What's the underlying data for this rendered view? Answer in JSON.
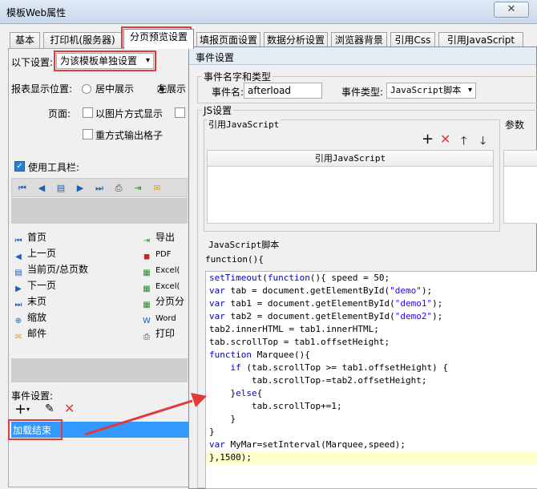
{
  "window": {
    "title": "模板Web属性",
    "close_label": "✕"
  },
  "tabs": [
    {
      "label": "基本"
    },
    {
      "label": "打印机(服务器)"
    },
    {
      "label": "分页预览设置"
    },
    {
      "label": "填报页面设置"
    },
    {
      "label": "数据分析设置"
    },
    {
      "label": "浏览器背景"
    },
    {
      "label": "引用Css"
    },
    {
      "label": "引用JavaScript"
    }
  ],
  "left": {
    "setting_label": "以下设置:",
    "setting_value": "为该模板单独设置",
    "position_label": "报表显示位置:",
    "position_center": "居中展示",
    "position_left": "左展示",
    "page_label": "页面:",
    "opt_image_page": "以图片方式显示",
    "opt_overlay_grid": "重方式输出格子",
    "use_toolbar": "使用工具栏:",
    "toolbar_items": [
      {
        "label": "首页",
        "icon": "first-page-icon"
      },
      {
        "label": "上一页",
        "icon": "prev-page-icon"
      },
      {
        "label": "当前页/总页数",
        "icon": "page-count-icon"
      },
      {
        "label": "下一页",
        "icon": "next-page-icon"
      },
      {
        "label": "末页",
        "icon": "last-page-icon"
      },
      {
        "label": "缩放",
        "icon": "zoom-icon"
      },
      {
        "label": "邮件",
        "icon": "mail-icon"
      }
    ],
    "export_items": [
      {
        "label": "导出",
        "icon": "export-icon"
      },
      {
        "label": "PDF",
        "icon": "pdf-icon"
      },
      {
        "label": "Excel(",
        "icon": "excel-icon"
      },
      {
        "label": "Excel(",
        "icon": "excel-icon"
      },
      {
        "label": "分页分",
        "icon": "excel-icon"
      },
      {
        "label": "Word",
        "icon": "word-icon"
      },
      {
        "label": "打印",
        "icon": "print-icon"
      }
    ],
    "event_settings_label": "事件设置:",
    "event_item": "加载结束"
  },
  "dialog": {
    "title": "事件设置",
    "group_name_type": "事件名字和类型",
    "event_name_label": "事件名:",
    "event_name_value": "afterload",
    "event_type_label": "事件类型:",
    "event_type_value": "JavaScript脚本",
    "group_js": "JS设置",
    "ref_js_label": "引用JavaScript",
    "params_label": "参数",
    "ref_js_header": "引用JavaScript",
    "script_label": "JavaScript脚本",
    "func_header": "function(){"
  },
  "code_lines": [
    "setTimeout(function(){ speed = 50;",
    "var tab = document.getElementById(\"demo\");",
    "var tab1 = document.getElementById(\"demo1\");",
    "var tab2 = document.getElementById(\"demo2\");",
    "tab2.innerHTML = tab1.innerHTML;",
    "tab.scrollTop = tab1.offsetHeight;",
    "function Marquee(){",
    "    if (tab.scrollTop >= tab1.offsetHeight) {",
    "        tab.scrollTop-=tab2.offsetHeight;",
    "    }else{",
    "        tab.scrollTop+=1;",
    "    }",
    "}",
    "var MyMar=setInterval(Marquee,speed);",
    "},1500);"
  ],
  "colors": {
    "accent_red": "#e03a3a",
    "selection_blue": "#3399ff",
    "highlight_yellow": "#ffffcc"
  }
}
